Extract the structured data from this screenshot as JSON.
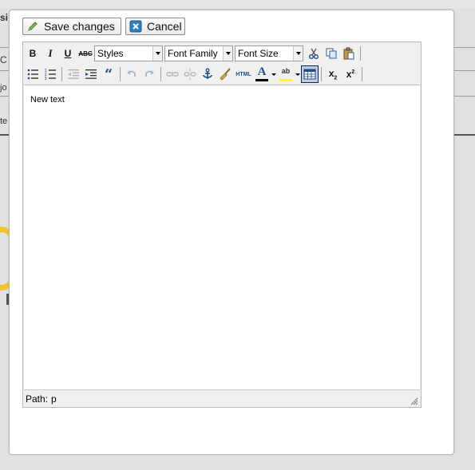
{
  "background": {
    "frag_1": "si",
    "frag_2": "C",
    "frag_3": "jo",
    "frag_4": "te"
  },
  "dialog": {
    "save_label": "Save changes",
    "cancel_label": "Cancel"
  },
  "toolbar": {
    "bold": "B",
    "italic": "I",
    "underline": "U",
    "strikethrough": "ABC",
    "styles_select": "Styles",
    "font_family_select": "Font Family",
    "font_size_select": "Font Size",
    "html_label": "HTML",
    "forecolor_label": "A",
    "backcolor_label": "ab",
    "subscript": "x",
    "subscript_sub": "2",
    "superscript": "x",
    "superscript_sup": "2"
  },
  "colors": {
    "forecolor": "#000000",
    "backcolor": "#ffff00",
    "accent": "#0a246a"
  },
  "content": {
    "text": "New text"
  },
  "statusbar": {
    "path_label": "Path:",
    "path_value": "p"
  }
}
